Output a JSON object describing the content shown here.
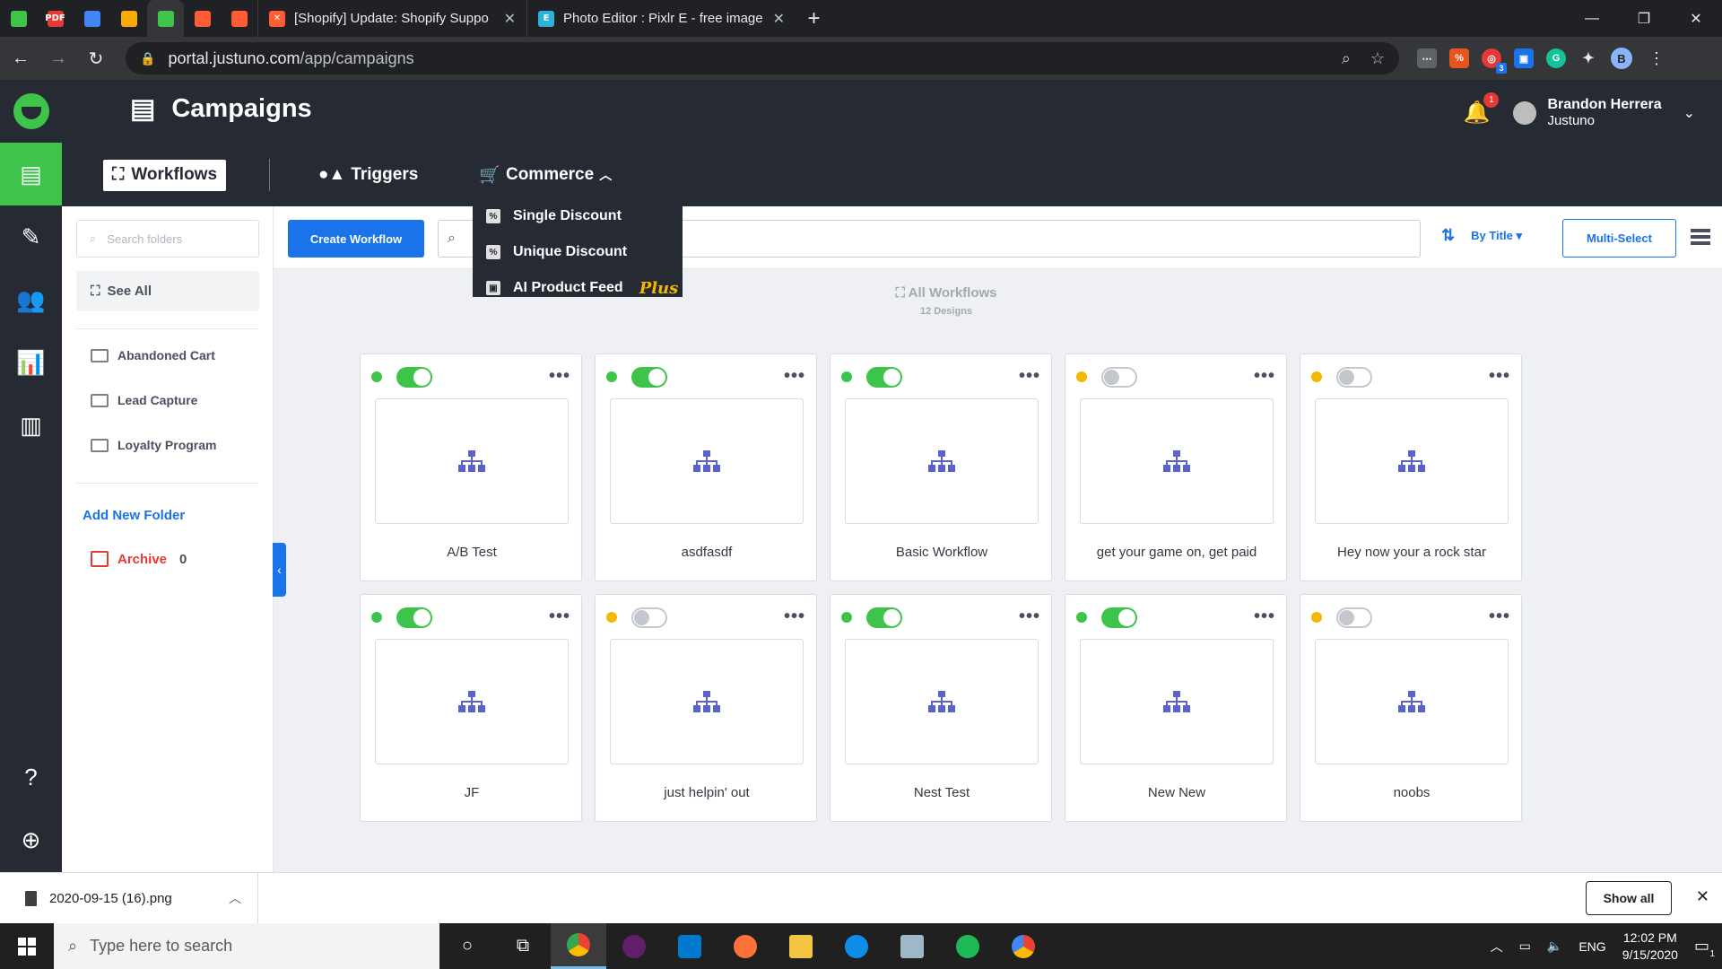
{
  "browser": {
    "pinned_tabs": [
      {
        "icon": "justuno-icon",
        "color": "#3ec44a",
        "label": ""
      },
      {
        "icon": "pdf-icon",
        "color": "#e53935",
        "label": "PDF"
      },
      {
        "icon": "docs-icon",
        "color": "#4285f4",
        "label": ""
      },
      {
        "icon": "keep-icon",
        "color": "#f9ab00",
        "label": ""
      },
      {
        "icon": "justuno-icon",
        "color": "#3ec44a",
        "label": ""
      },
      {
        "icon": "hubspot-icon",
        "color": "#ff5c35",
        "label": ""
      },
      {
        "icon": "hubspot-icon",
        "color": "#ff5c35",
        "label": ""
      }
    ],
    "tabs": [
      {
        "title": "[Shopify] Update: Shopify Suppo",
        "icon": "hubspot-icon",
        "color": "#ff5c35"
      },
      {
        "title": "Photo Editor : Pixlr E - free image",
        "icon": "pixlr-icon",
        "color": "#2bb3d9"
      }
    ],
    "url_host": "portal.justuno.com",
    "url_path": "/app/campaigns",
    "profile_initial": "B",
    "ext_badge": "3"
  },
  "app": {
    "page_title": "Campaigns",
    "user": {
      "name": "Brandon Herrera",
      "org": "Justuno",
      "notifications": "1"
    },
    "tabs": {
      "workflows": "Workflows",
      "triggers": "Triggers",
      "commerce": "Commerce"
    },
    "commerce_menu": [
      {
        "label": "Single Discount",
        "icon": "percent-icon"
      },
      {
        "label": "Unique Discount",
        "icon": "percent-icon"
      },
      {
        "label": "AI Product Feed",
        "icon": "bag-icon",
        "tag": "Plus"
      }
    ],
    "folders": {
      "search_placeholder": "Search folders",
      "see_all": "See All",
      "items": [
        "Abandoned Cart",
        "Lead Capture",
        "Loyalty Program"
      ],
      "add_new": "Add New Folder",
      "archive_label": "Archive",
      "archive_count": "0"
    },
    "toolbar": {
      "create_label": "Create Workflow",
      "sort_label": "By Title",
      "multiselect_label": "Multi-Select"
    },
    "heading": {
      "title": "All Workflows",
      "subtitle": "12 Designs"
    },
    "workflows": [
      {
        "name": "A/B Test",
        "enabled": true,
        "status_color": "#3ec44a"
      },
      {
        "name": "asdfasdf",
        "enabled": true,
        "status_color": "#3ec44a"
      },
      {
        "name": "Basic Workflow",
        "enabled": true,
        "status_color": "#3ec44a"
      },
      {
        "name": "get your game on, get paid",
        "enabled": false,
        "status_color": "#f5b800"
      },
      {
        "name": "Hey now your a rock star",
        "enabled": false,
        "status_color": "#f5b800"
      },
      {
        "name": "JF",
        "enabled": true,
        "status_color": "#3ec44a"
      },
      {
        "name": "just helpin' out",
        "enabled": false,
        "status_color": "#f5b800"
      },
      {
        "name": "Nest Test",
        "enabled": true,
        "status_color": "#3ec44a"
      },
      {
        "name": "New New",
        "enabled": true,
        "status_color": "#3ec44a"
      },
      {
        "name": "noobs",
        "enabled": false,
        "status_color": "#f5b800"
      }
    ]
  },
  "downloads": {
    "filename": "2020-09-15 (16).png",
    "show_all": "Show all"
  },
  "taskbar": {
    "search_placeholder": "Type here to search",
    "lang": "ENG",
    "time": "12:02 PM",
    "date": "9/15/2020",
    "notif_count": "1"
  }
}
